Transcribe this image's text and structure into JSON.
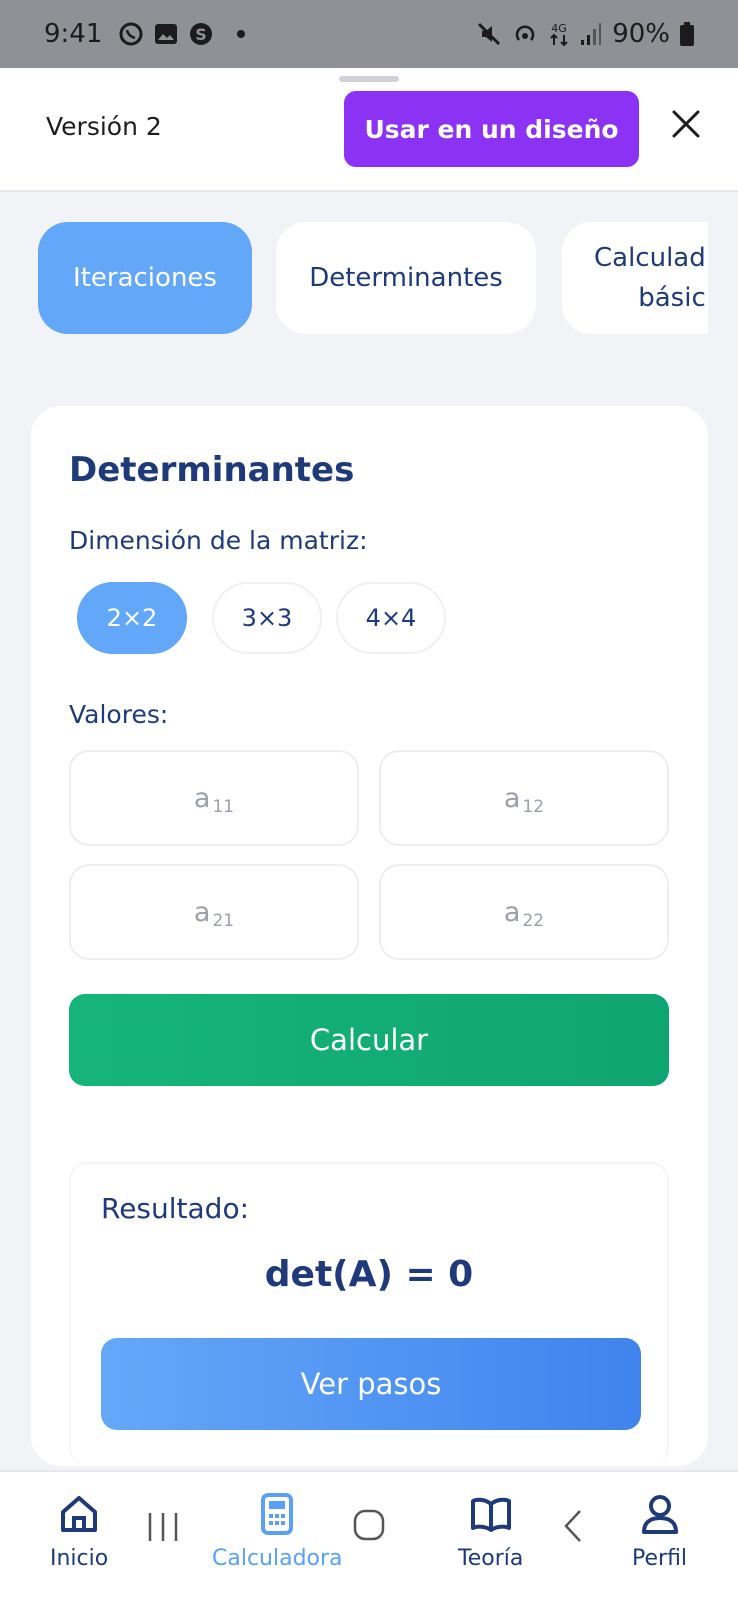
{
  "status_bar": {
    "time": "9:41",
    "battery": "90%",
    "icons_left": [
      "whatsapp-icon",
      "gallery-icon",
      "skype-icon",
      "dot-icon"
    ],
    "icons_right": [
      "mute-icon",
      "hotspot-icon",
      "network-4g-icon",
      "signal-icon",
      "battery-icon"
    ]
  },
  "sheet": {
    "version_label": "Versión 2",
    "use_button": "Usar en un diseño",
    "close_icon": "close-icon"
  },
  "tabs": [
    {
      "label": "Iteraciones",
      "active": true
    },
    {
      "label": "Determinantes",
      "active": false
    },
    {
      "label_line1": "Calculad",
      "label_line2": "básic",
      "active": false
    }
  ],
  "card": {
    "title": "Determinantes",
    "dimension_label": "Dimensión de la matriz:",
    "dimensions": [
      "2×2",
      "3×3",
      "4×4"
    ],
    "selected_dimension": "2×2",
    "values_label": "Valores:",
    "cells": [
      {
        "base": "a",
        "sub": "11"
      },
      {
        "base": "a",
        "sub": "12"
      },
      {
        "base": "a",
        "sub": "21"
      },
      {
        "base": "a",
        "sub": "22"
      }
    ],
    "calculate_button": "Calcular",
    "result_label": "Resultado:",
    "result_value": "det(A) = 0",
    "steps_button": "Ver pasos"
  },
  "bottom_nav": {
    "items": [
      {
        "label": "Inicio",
        "icon": "home-icon",
        "active": false
      },
      {
        "label": "Calculadora",
        "icon": "calculator-icon",
        "active": true
      },
      {
        "label": "Teoría",
        "icon": "book-icon",
        "active": false
      },
      {
        "label": "Perfil",
        "icon": "user-icon",
        "active": false
      }
    ],
    "system_buttons": [
      "recents-icon",
      "home-system-icon",
      "back-icon"
    ]
  },
  "colors": {
    "accent_purple": "#8b32f4",
    "accent_blue": "#63a7f8",
    "accent_green": "#16b47b",
    "text_navy": "#1f3a7a"
  }
}
